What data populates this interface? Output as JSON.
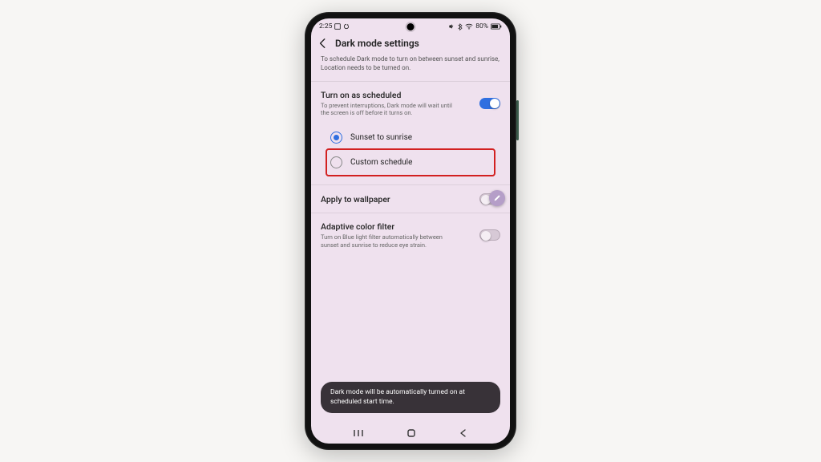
{
  "statusbar": {
    "time": "2:25",
    "left_icons": [
      "recent-apps-icon",
      "refresh-icon"
    ],
    "bluetooth": true,
    "wifi": true,
    "signal": true,
    "battery_pct": "80%"
  },
  "header": {
    "title": "Dark mode settings"
  },
  "location_hint": "To schedule Dark mode to turn on between sunset and sunrise, Location needs to be turned on.",
  "scheduled": {
    "title": "Turn on as scheduled",
    "subtitle": "To prevent interruptions, Dark mode will wait until the screen is off before it turns on.",
    "enabled": true
  },
  "schedule_options": {
    "sunset": {
      "label": "Sunset to sunrise",
      "selected": true
    },
    "custom": {
      "label": "Custom schedule",
      "selected": false,
      "highlighted": true
    }
  },
  "wallpaper": {
    "title": "Apply to wallpaper",
    "enabled": false
  },
  "adaptive": {
    "title": "Adaptive color filter",
    "subtitle": "Turn on Blue light filter automatically between sunset and sunrise to reduce eye strain.",
    "enabled": false
  },
  "toast": "Dark mode will be automatically turned on at scheduled start time.",
  "colors": {
    "accent": "#2f6fe0",
    "highlight": "#d22020"
  }
}
